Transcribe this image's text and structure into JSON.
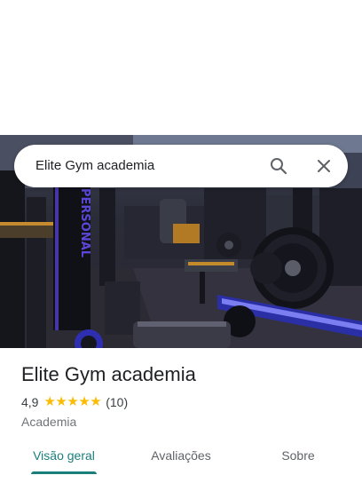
{
  "search": {
    "query": "Elite Gym academia",
    "search_icon": "search-icon",
    "clear_icon": "close-icon"
  },
  "photo": {
    "wall_text": "PERSONAL"
  },
  "place": {
    "name": "Elite Gym academia",
    "rating": "4,9",
    "rating_fraction": 0.98,
    "star_glyph": "★",
    "reviews_count": "(10)",
    "category": "Academia"
  },
  "tabs": [
    {
      "label": "Visão geral",
      "active": true
    },
    {
      "label": "Avaliações",
      "active": false
    },
    {
      "label": "Sobre",
      "active": false
    }
  ],
  "colors": {
    "accent": "#1a7f7a",
    "star": "#fbbc04"
  }
}
